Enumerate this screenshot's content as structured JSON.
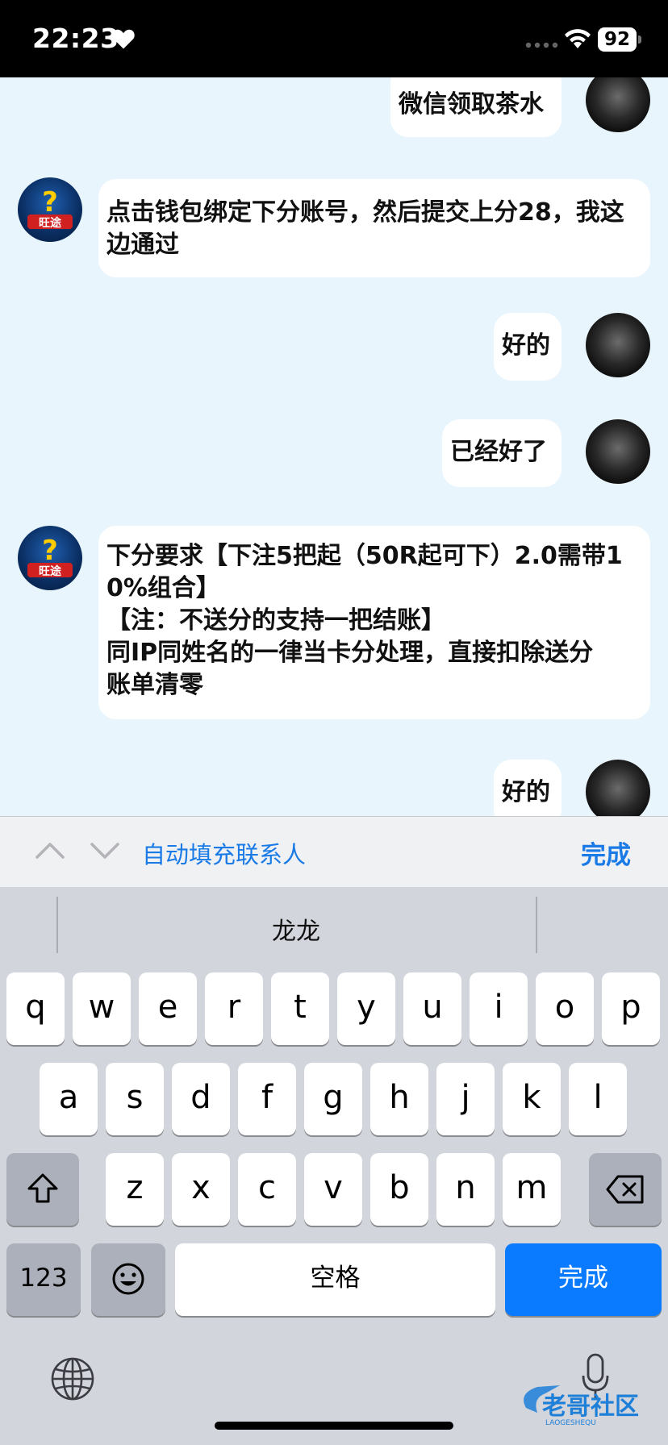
{
  "status_bar": {
    "time": "22:23",
    "battery": "92"
  },
  "messages": [
    {
      "side": "right",
      "text": "微信领取茶水"
    },
    {
      "side": "left",
      "text": "点击钱包绑定下分账号，然后提交上分28，我这边通过"
    },
    {
      "side": "right",
      "text": "好的"
    },
    {
      "side": "right",
      "text": "已经好了"
    },
    {
      "side": "left",
      "lines": [
        "下分要求【下注5把起（50R起可下）2.0需带1",
        "0%组合】",
        "【注：不送分的支持一把结账】",
        "同IP同姓名的一律当卡分处理，直接扣除送分",
        "账单清零"
      ]
    },
    {
      "side": "right",
      "text": "好的"
    }
  ],
  "avatar_bot_text": "旺途",
  "accessory_bar": {
    "autofill": "自动填充联系人",
    "done": "完成"
  },
  "keyboard": {
    "candidate": "龙龙",
    "row1": [
      "q",
      "w",
      "e",
      "r",
      "t",
      "y",
      "u",
      "i",
      "o",
      "p"
    ],
    "row2": [
      "a",
      "s",
      "d",
      "f",
      "g",
      "h",
      "j",
      "k",
      "l"
    ],
    "row3": [
      "z",
      "x",
      "c",
      "v",
      "b",
      "n",
      "m"
    ],
    "numbers": "123",
    "space": "空格",
    "done": "完成"
  },
  "watermark": {
    "title": "老哥社区",
    "sub": "LAOGESHEQU"
  },
  "colors": {
    "chat_bg": "#e9f5fd",
    "accent": "#0a7aff",
    "link": "#1a7ae6"
  }
}
